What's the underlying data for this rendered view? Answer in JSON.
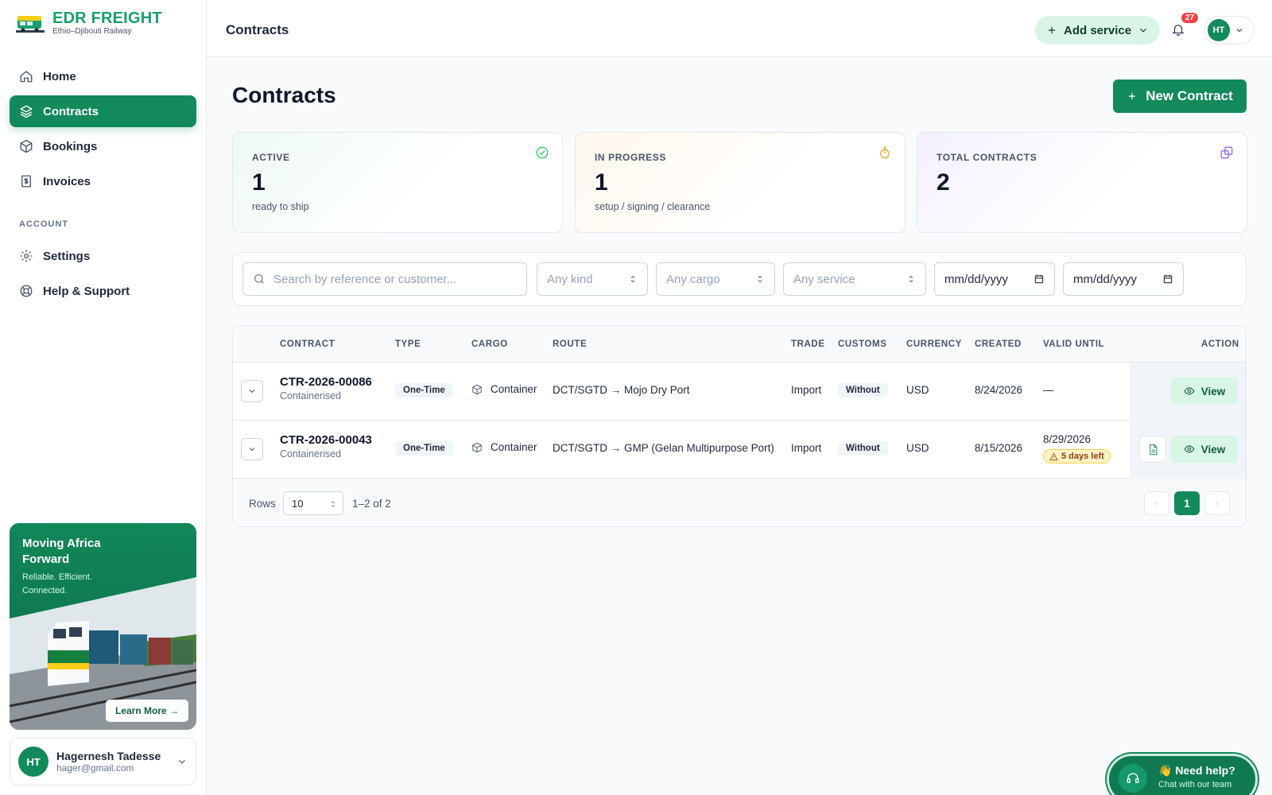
{
  "brand": {
    "name": "EDR FREIGHT",
    "subtitle": "Ethio–Djibouti Railway"
  },
  "nav": {
    "items": [
      {
        "label": "Home",
        "icon": "home-icon"
      },
      {
        "label": "Contracts",
        "icon": "layers-icon",
        "active": true
      },
      {
        "label": "Bookings",
        "icon": "box-icon"
      },
      {
        "label": "Invoices",
        "icon": "invoice-icon"
      }
    ],
    "account_heading": "ACCOUNT",
    "account_items": [
      {
        "label": "Settings",
        "icon": "gear-icon"
      },
      {
        "label": "Help & Support",
        "icon": "lifebuoy-icon"
      }
    ]
  },
  "promo": {
    "title": "Moving Africa Forward",
    "text": "Reliable. Efficient. Connected.",
    "button": "Learn More →"
  },
  "user": {
    "initials": "HT",
    "name": "Hagernesh Tadesse",
    "email": "hager@gmail.com"
  },
  "header": {
    "title": "Contracts",
    "add_service": "Add service",
    "notifications_count": "27",
    "avatar_initials": "HT"
  },
  "page": {
    "title": "Contracts",
    "new_button": "New Contract"
  },
  "stats": [
    {
      "label": "ACTIVE",
      "value": "1",
      "sub": "ready to ship",
      "icon": "check-circle-icon",
      "color": "#22c55e"
    },
    {
      "label": "IN PROGRESS",
      "value": "1",
      "sub": "setup / signing / clearance",
      "icon": "stopwatch-icon",
      "color": "#f59e0b"
    },
    {
      "label": "TOTAL CONTRACTS",
      "value": "2",
      "sub": "",
      "icon": "copy-icon",
      "color": "#8b5cf6"
    }
  ],
  "filters": {
    "search_placeholder": "Search by reference or customer...",
    "kind": "Any kind",
    "cargo": "Any cargo",
    "service": "Any service",
    "date_from": "mm/dd/yyyy",
    "date_to": "mm/dd/yyyy"
  },
  "table": {
    "columns": [
      "CONTRACT",
      "TYPE",
      "CARGO",
      "ROUTE",
      "TRADE",
      "CUSTOMS",
      "CURRENCY",
      "CREATED",
      "VALID UNTIL",
      "ACTION"
    ],
    "rows": [
      {
        "ref": "CTR-2026-00086",
        "sub": "Containerised",
        "type": "One-Time",
        "cargo": "Container",
        "route": "DCT/SGTD → Mojo Dry Port",
        "trade": "Import",
        "customs": "Without",
        "currency": "USD",
        "created": "8/24/2026",
        "valid_until": "—",
        "warning": "",
        "view": "View"
      },
      {
        "ref": "CTR-2026-00043",
        "sub": "Containerised",
        "type": "One-Time",
        "cargo": "Container",
        "route": "DCT/SGTD → GMP (Gelan Multipurpose Port)",
        "trade": "Import",
        "customs": "Without",
        "currency": "USD",
        "created": "8/15/2026",
        "valid_until": "8/29/2026",
        "warning": "5 days left",
        "view": "View"
      }
    ],
    "rows_label": "Rows",
    "rows_per_page": "10",
    "range": "1–2 of 2",
    "current_page": "1"
  },
  "help": {
    "title": "👋 Need help?",
    "sub": "Chat with our team"
  },
  "colors": {
    "accent": "#138a5c",
    "accent_light": "#d9f5e8",
    "badge": "#ef4444"
  }
}
